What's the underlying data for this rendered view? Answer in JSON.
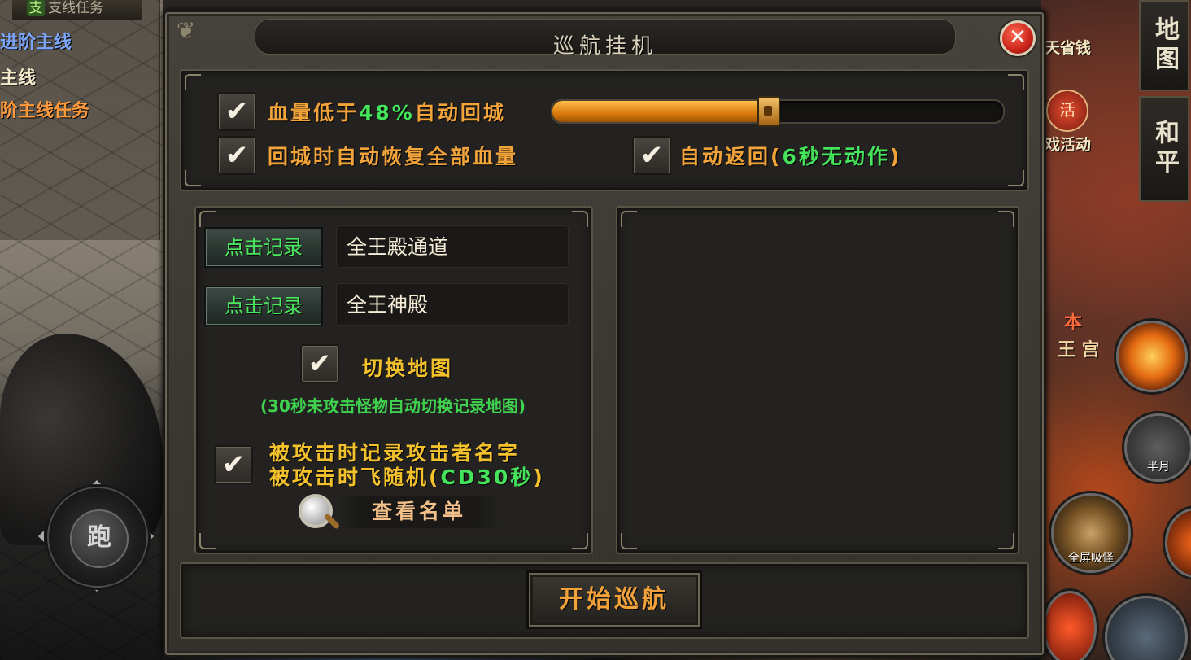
{
  "background": {
    "quest_header": "支线任务",
    "quest_header_mark": "支",
    "quests": [
      "进阶主线",
      "主线",
      "阶主线任务"
    ],
    "joystick_label": "跑",
    "side_buttons": [
      "地图",
      "和平"
    ],
    "right_labels": [
      "天省钱",
      "戏活动"
    ],
    "event_icon_glyph": "活",
    "map_labels": [
      "本",
      "王 宫"
    ],
    "skills": [
      "半月",
      "全屏吸怪"
    ]
  },
  "dialog": {
    "title": "巡航挂机",
    "close_glyph": "✕",
    "options": {
      "hp_prefix": "血量低于",
      "hp_value": "48%",
      "hp_suffix": "自动回城",
      "hp_percent": 48,
      "restore_label": "回城时自动恢复全部血量",
      "auto_return_prefix": "自动返回(",
      "auto_return_value": "6秒无动作",
      "auto_return_suffix": ")"
    },
    "records": [
      {
        "button": "点击记录",
        "value": "全王殿通道"
      },
      {
        "button": "点击记录",
        "value": "全王神殿"
      }
    ],
    "switch_map_label": "切换地图",
    "switch_map_hint": "(30秒未攻击怪物自动切换记录地图)",
    "attacked_line1": "被攻击时记录攻击者名字",
    "attacked_line2_prefix": "被攻击时飞随机(",
    "attacked_line2_value": "CD30秒",
    "attacked_line2_suffix": ")",
    "view_list_label": "查看名单",
    "start_button": "开始巡航",
    "check_glyph": "✔"
  },
  "colors": {
    "orange_text": "#f2a43a",
    "green_text": "#44e55a",
    "slider_fill": "#d97a0b"
  }
}
